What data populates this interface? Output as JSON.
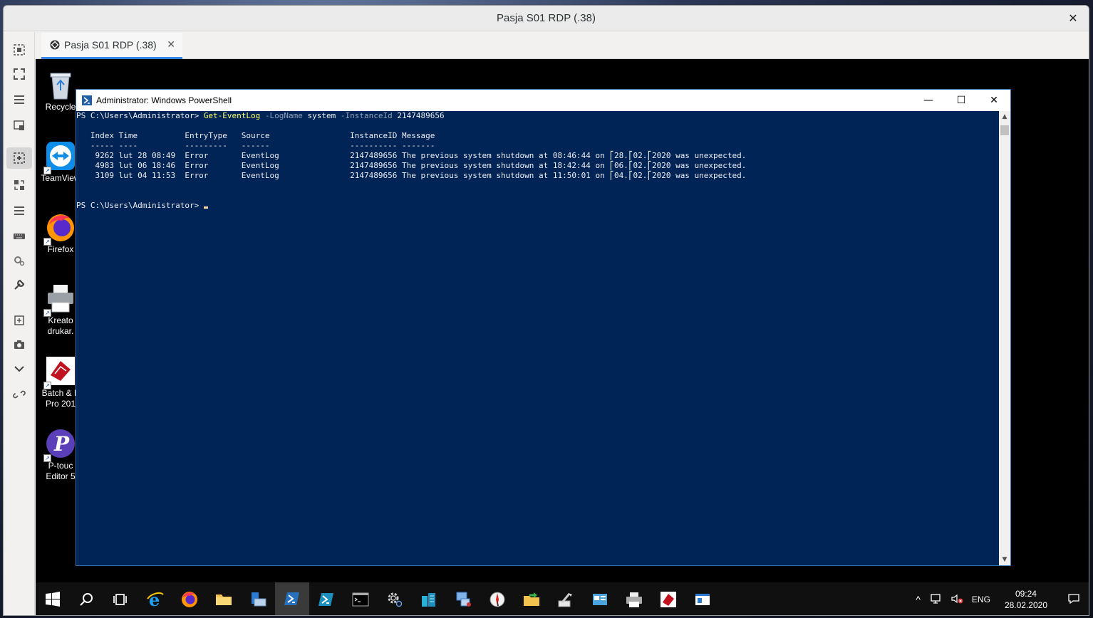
{
  "outer": {
    "title": "Pasja S01 RDP (.38)",
    "close_glyph": "✕",
    "tab_label": "Pasja S01 RDP (.38)",
    "tab_close_glyph": "✕"
  },
  "toolbar_icons": [
    "fit-window-icon",
    "fullscreen-icon",
    "menu-icon",
    "window-icon",
    "scale-icon",
    "resize-icon",
    "list-icon",
    "keyboard-icon",
    "preferences-icon",
    "tools-icon",
    "add-screen-icon",
    "screenshot-icon",
    "chevron-down-icon",
    "disconnect-icon"
  ],
  "desktop_icons": [
    {
      "label1": "Recycle",
      "label2": "",
      "icon": "recycle-bin-icon"
    },
    {
      "label1": "TeamView",
      "label2": "",
      "icon": "teamviewer-icon"
    },
    {
      "label1": "Firefox",
      "label2": "",
      "icon": "firefox-icon"
    },
    {
      "label1": "Kreato",
      "label2": "drukar.",
      "icon": "printer-icon"
    },
    {
      "label1": "Batch & F",
      "label2": "Pro 201",
      "icon": "batch-icon"
    },
    {
      "label1": "P-touc",
      "label2": "Editor 5",
      "icon": "ptouch-icon"
    }
  ],
  "powershell": {
    "title": "Administrator: Windows PowerShell",
    "min_glyph": "—",
    "max_glyph": "☐",
    "close_glyph": "✕",
    "prompt": "PS C:\\Users\\Administrator> ",
    "command": "Get-EventLog",
    "param1": "-LogName",
    "arg1": "system",
    "param2": "-InstanceId",
    "arg2": "2147489656",
    "header": "   Index Time          EntryType   Source                 InstanceID Message",
    "separator": "   ----- ----          ---------   ------                 ---------- -------",
    "rows": [
      "    9262 lut 28 08:49  Error       EventLog               2147489656 The previous system shutdown at 08:46:44 on ⎡28.⎡02.⎡2020 was unexpected.",
      "    4983 lut 06 18:46  Error       EventLog               2147489656 The previous system shutdown at 18:42:44 on ⎡06.⎡02.⎡2020 was unexpected.",
      "    3109 lut 04 11:53  Error       EventLog               2147489656 The previous system shutdown at 11:50:01 on ⎡04.⎡02.⎡2020 was unexpected."
    ],
    "prompt2": "PS C:\\Users\\Administrator> "
  },
  "taskbar": {
    "apps": [
      "start-icon",
      "search-icon",
      "task-view-icon",
      "internet-explorer-icon",
      "firefox-icon",
      "file-explorer-icon",
      "server-manager-icon",
      "powershell-icon",
      "powershell-ise-icon",
      "cmd-icon",
      "settings-gear-icon",
      "database-icon",
      "network-icon",
      "compass-icon",
      "sync-folder-icon",
      "tools-icon",
      "control-panel-icon",
      "printer-icon",
      "batch-icon",
      "app-window-icon"
    ],
    "active_index": 7,
    "lang": "ENG",
    "time": "09:24",
    "date": "28.02.2020",
    "tray_up_glyph": "^"
  }
}
